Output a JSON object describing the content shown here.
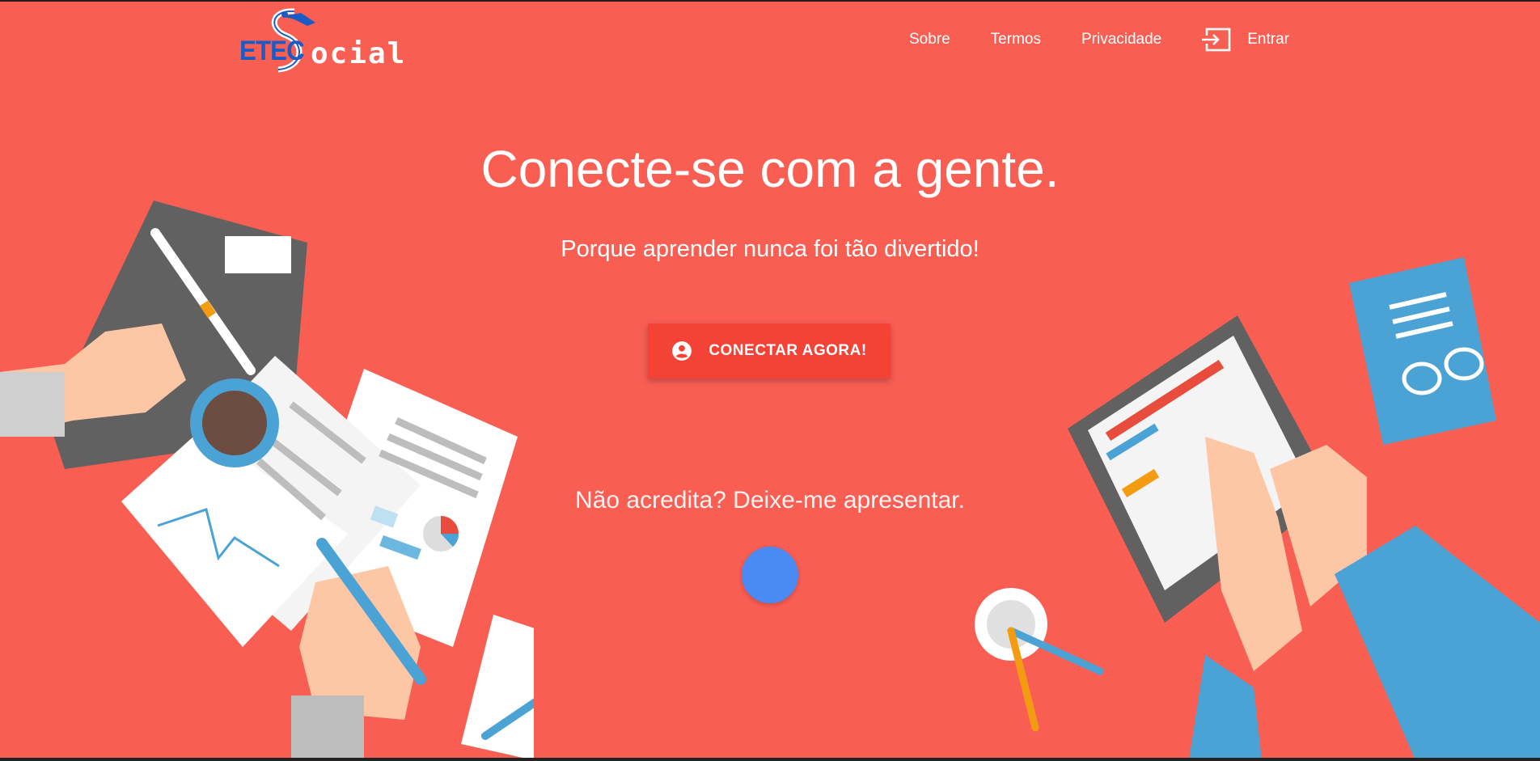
{
  "header": {
    "logo": {
      "part1": "ETEC",
      "part2": "ocial"
    },
    "nav": [
      {
        "label": "Sobre"
      },
      {
        "label": "Termos"
      },
      {
        "label": "Privacidade"
      },
      {
        "label": "Entrar",
        "icon": "login-icon"
      }
    ]
  },
  "hero": {
    "title": "Conecte-se com a gente.",
    "subtitle": "Porque aprender nunca foi tão divertido!",
    "cta_label": "CONECTAR AGORA!",
    "cta_icon": "account-circle-icon",
    "tease": "Não acredita? Deixe-me apresentar."
  },
  "colors": {
    "background": "#f95e53",
    "cta": "#f44336",
    "dot": "#4a8af4",
    "logo_blue": "#1d5bc4"
  }
}
